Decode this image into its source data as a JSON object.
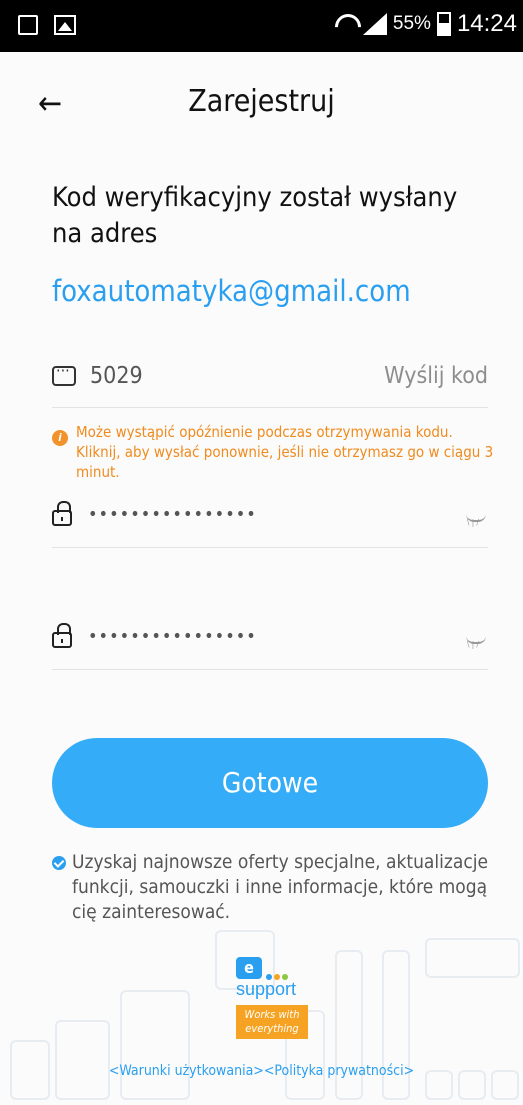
{
  "status_bar": {
    "battery_pct": "55%",
    "time": "14:24"
  },
  "header": {
    "back_icon": "arrow-left-icon",
    "title": "Zarejestruj"
  },
  "main": {
    "heading": "Kod weryfikacyjny został wysłany na adres",
    "email": "foxautomatyka@gmail.com",
    "code_field": {
      "value": "5029",
      "send_label": "Wyślij kod"
    },
    "warning": "Może wystąpić opóźnienie podczas otrzymywania kodu. Kliknij, aby wysłać ponownie, jeśli nie otrzymasz go w ciągu 3 minut.",
    "password_1": "••••••••••••••••",
    "password_2": "••••••••••••••••",
    "done_label": "Gotowe",
    "offers_text": "Uzyskaj najnowsze oferty specjalne, aktualizacje funkcji, samouczki i inne informacje, które mogą cię zainteresować.",
    "offers_checked": true
  },
  "footer": {
    "logo_e": "e",
    "logo_support": "support",
    "logo_works": "Works with everything",
    "terms_link": "<Warunki użytkowania>",
    "privacy_link": "<Polityka prywatności>"
  },
  "colors": {
    "accent": "#2a9ff0",
    "button": "#35acf7",
    "warning": "#f08b1e"
  }
}
